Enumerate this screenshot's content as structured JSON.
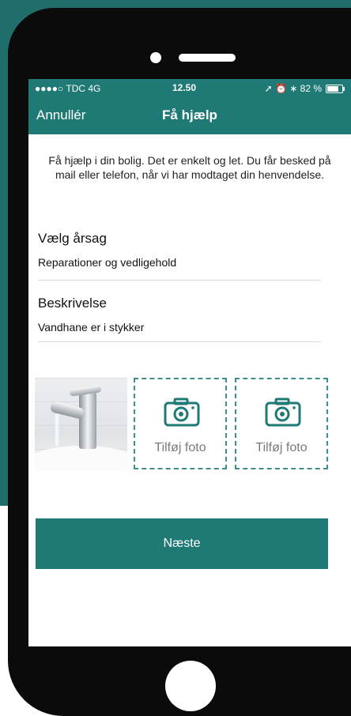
{
  "status_bar": {
    "carrier": "●●●●○ TDC  4G",
    "time": "12.50",
    "right": "➚ ⏰ ∗ 82 %"
  },
  "nav": {
    "cancel_label": "Annullér",
    "title": "Få hjælp"
  },
  "intro": "Få hjælp i din bolig. Det er enkelt og let. Du får besked på mail eller telefon, når vi har modtaget din henvendelse.",
  "form": {
    "reason": {
      "label": "Vælg årsag",
      "value": "Reparationer og vedligehold"
    },
    "description": {
      "label": "Beskrivelse",
      "value": "Vandhane er i stykker"
    }
  },
  "photos": {
    "add_label_1": "Tilføj foto",
    "add_label_2": "Tilføj foto"
  },
  "next_label": "Næste",
  "colors": {
    "accent": "#1f7a76",
    "background": "#1f6e6b"
  },
  "icons": {
    "camera": "camera-icon",
    "battery": "battery-icon"
  }
}
